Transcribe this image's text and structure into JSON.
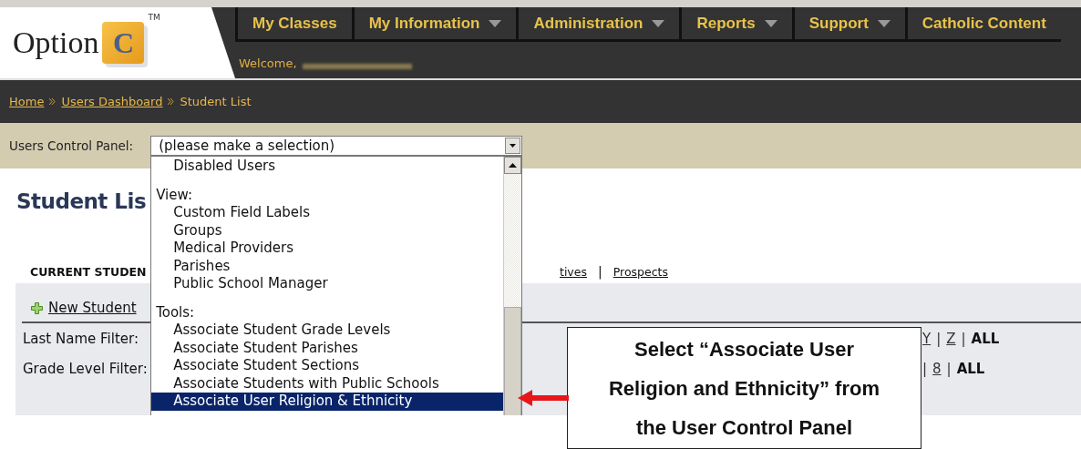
{
  "logo": {
    "word": "Option",
    "mark": "C",
    "trademark": "TM"
  },
  "nav": [
    {
      "label": "My Classes",
      "has_menu": false
    },
    {
      "label": "My Information",
      "has_menu": true
    },
    {
      "label": "Administration",
      "has_menu": true
    },
    {
      "label": "Reports",
      "has_menu": true
    },
    {
      "label": "Support",
      "has_menu": true
    },
    {
      "label": "Catholic Content",
      "has_menu": false
    }
  ],
  "welcome": "Welcome,",
  "breadcrumb": [
    {
      "label": "Home",
      "link": true
    },
    {
      "label": "Users Dashboard",
      "link": true
    },
    {
      "label": "Student List",
      "link": false
    }
  ],
  "control_panel": {
    "label": "Users Control Panel:",
    "value": "(please make a selection)",
    "groups": [
      {
        "items": [
          {
            "label": "Disabled Users",
            "selected": false
          }
        ]
      },
      {
        "label": "View:",
        "items": [
          {
            "label": "Custom Field Labels",
            "selected": false
          },
          {
            "label": "Groups",
            "selected": false
          },
          {
            "label": "Medical Providers",
            "selected": false
          },
          {
            "label": "Parishes",
            "selected": false
          },
          {
            "label": "Public School Manager",
            "selected": false
          }
        ]
      },
      {
        "label": "Tools:",
        "items": [
          {
            "label": "Associate Student Grade Levels",
            "selected": false
          },
          {
            "label": "Associate Student Parishes",
            "selected": false
          },
          {
            "label": "Associate Student Sections",
            "selected": false
          },
          {
            "label": "Associate Students with Public Schools",
            "selected": false
          },
          {
            "label": "Associate User Religion & Ethnicity",
            "selected": true
          }
        ]
      }
    ]
  },
  "heading": "Student Lis",
  "tabs": [
    {
      "label": "CURRENT STUDEN",
      "selected": true
    },
    {
      "label": "tives",
      "selected": false
    },
    {
      "label": "Prospects",
      "selected": false
    }
  ],
  "tab_separator": "|",
  "new_student": "New Student",
  "filters": [
    {
      "label": "Last Name Filter:",
      "links": [
        {
          "kind": "letter",
          "text": "Y"
        },
        {
          "kind": "separator",
          "text": "|"
        },
        {
          "kind": "letter",
          "text": "Z"
        },
        {
          "kind": "separator",
          "text": "|"
        },
        {
          "kind": "all",
          "text": "ALL"
        }
      ]
    },
    {
      "label": "Grade Level Filter:",
      "links": [
        {
          "kind": "separator",
          "text": "|"
        },
        {
          "kind": "letter",
          "text": "8"
        },
        {
          "kind": "separator",
          "text": "|"
        },
        {
          "kind": "all",
          "text": "ALL"
        }
      ]
    }
  ],
  "callout": "Select “Associate User Religion and Ethnicity” from the User Control Panel"
}
